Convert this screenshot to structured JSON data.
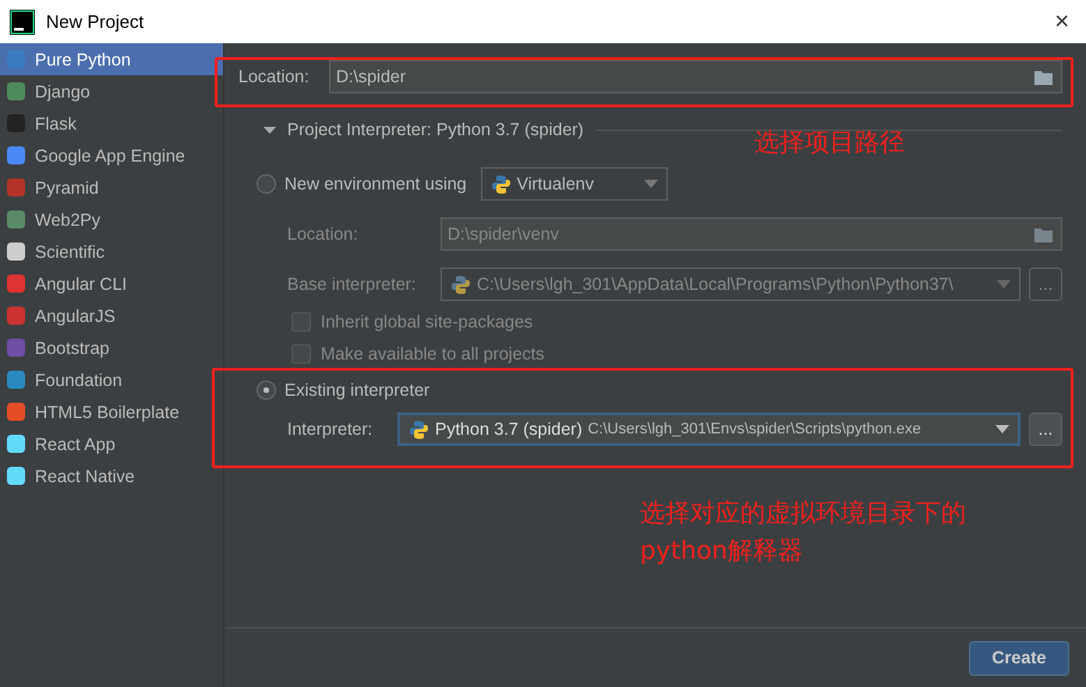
{
  "window": {
    "title": "New Project",
    "close": "×"
  },
  "sidebar": {
    "items": [
      {
        "label": "Pure Python",
        "selected": true
      },
      {
        "label": "Django",
        "selected": false
      },
      {
        "label": "Flask",
        "selected": false
      },
      {
        "label": "Google App Engine",
        "selected": false
      },
      {
        "label": "Pyramid",
        "selected": false
      },
      {
        "label": "Web2Py",
        "selected": false
      },
      {
        "label": "Scientific",
        "selected": false
      },
      {
        "label": "Angular CLI",
        "selected": false
      },
      {
        "label": "AngularJS",
        "selected": false
      },
      {
        "label": "Bootstrap",
        "selected": false
      },
      {
        "label": "Foundation",
        "selected": false
      },
      {
        "label": "HTML5 Boilerplate",
        "selected": false
      },
      {
        "label": "React App",
        "selected": false
      },
      {
        "label": "React Native",
        "selected": false
      }
    ]
  },
  "location": {
    "label": "Location:",
    "value": "D:\\spider"
  },
  "interpreter_section": {
    "title": "Project Interpreter: Python 3.7 (spider)",
    "expanded": true
  },
  "new_environment": {
    "label": "New environment using",
    "selected": false,
    "tool": "Virtualenv",
    "location_label": "Location:",
    "location": "D:\\spider\\venv",
    "base_label": "Base interpreter:",
    "base": "C:\\Users\\lgh_301\\AppData\\Local\\Programs\\Python\\Python37\\",
    "more": "...",
    "checkboxes": [
      {
        "label": "Inherit global site-packages",
        "checked": false
      },
      {
        "label": "Make available to all projects",
        "checked": false
      }
    ]
  },
  "existing": {
    "label": "Existing interpreter",
    "selected": true,
    "interpreter_label": "Interpreter:",
    "name": "Python 3.7 (spider)",
    "path": "C:\\Users\\lgh_301\\Envs\\spider\\Scripts\\python.exe",
    "more": "..."
  },
  "annotations": [
    "选择项目路径",
    "选择对应的虚拟环境目录下的python解释器"
  ],
  "buttons": [
    "Create"
  ]
}
